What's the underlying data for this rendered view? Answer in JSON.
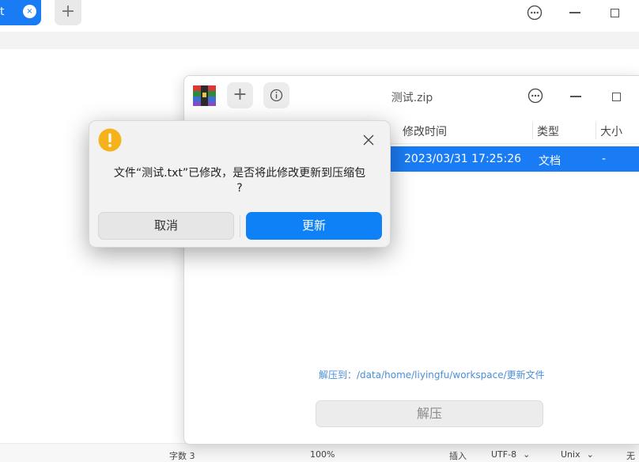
{
  "editor": {
    "tab_label": "t",
    "tab_close_symbol": "×",
    "add_tab_symbol": "+",
    "statusbar": {
      "char_count": "字数 3",
      "zoom": "100%",
      "insert_mode": "插入",
      "encoding": "UTF-8",
      "line_ending": "Unix",
      "highlight": "无"
    }
  },
  "archive": {
    "window_title": "测试.zip",
    "columns": [
      "修改时间",
      "类型",
      "大小"
    ],
    "rows": [
      {
        "modified": "2023/03/31 17:25:26",
        "type": "文档",
        "size": "-"
      }
    ],
    "extract_path": "解压到：/data/home/liyingfu/workspace/更新文件",
    "extract_label": "解压"
  },
  "dialog": {
    "message_line1": "文件“测试.txt”已修改，是否将此修改更新到压缩包",
    "message_line2": "?",
    "cancel_label": "取消",
    "update_label": "更新"
  },
  "colors": {
    "accent": "#1a7cf5",
    "warning": "#f6b21b"
  }
}
